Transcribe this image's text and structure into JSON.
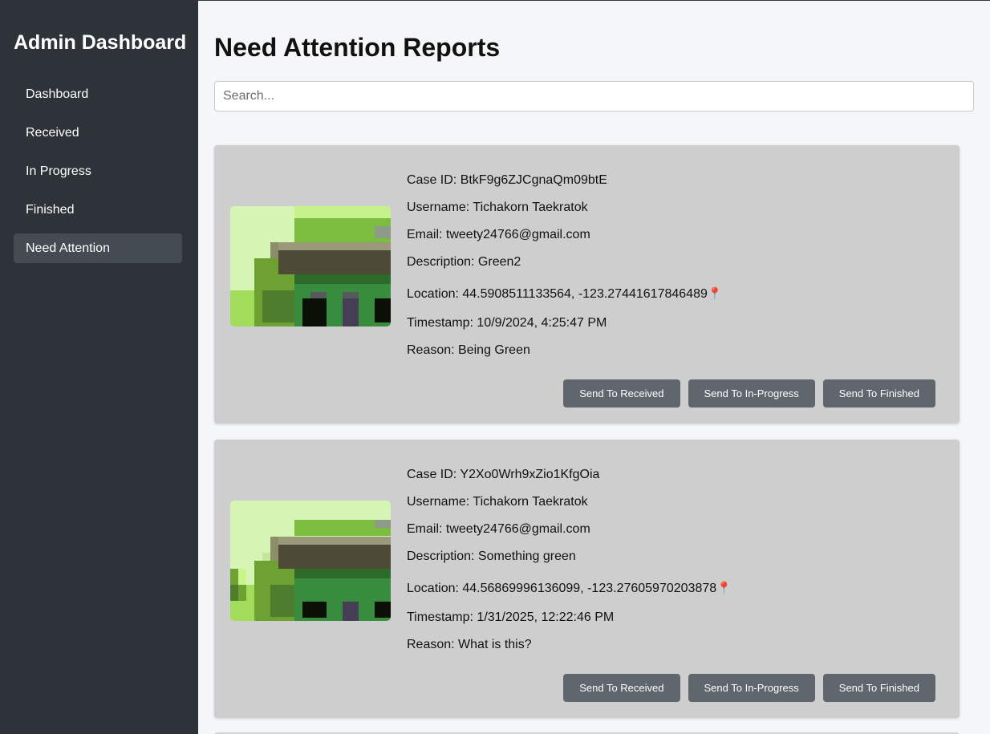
{
  "sidebar": {
    "title": "Admin Dashboard",
    "items": [
      {
        "label": "Dashboard"
      },
      {
        "label": "Received"
      },
      {
        "label": "In Progress"
      },
      {
        "label": "Finished"
      },
      {
        "label": "Need Attention"
      }
    ],
    "active_item": "Need Attention"
  },
  "main": {
    "title": "Need Attention Reports",
    "search": {
      "placeholder": "Search...",
      "value": ""
    }
  },
  "reports": [
    {
      "case_id": "Case ID: BtkF9g6ZJCgnaQm09btE",
      "username": "Username: Tichakorn Taekratok",
      "email": "Email: tweety24766@gmail.com",
      "description": "Description: Green2",
      "location": "Location: 44.5908511133564, -123.27441617846489",
      "timestamp": "Timestamp: 10/9/2024, 4:25:47 PM",
      "reason": "Reason: Being Green",
      "buttons": {
        "received": "Send To Received",
        "in_progress": "Send To In-Progress",
        "finished": "Send To Finished"
      }
    },
    {
      "case_id": "Case ID: Y2Xo0Wrh9xZio1KfgOia",
      "username": "Username: Tichakorn Taekratok",
      "email": "Email: tweety24766@gmail.com",
      "description": "Description: Something green",
      "location": "Location: 44.56869996136099, -123.27605970203878",
      "timestamp": "Timestamp: 1/31/2025, 12:22:46 PM",
      "reason": "Reason: What is this?",
      "buttons": {
        "received": "Send To Received",
        "in_progress": "Send To In-Progress",
        "finished": "Send To Finished"
      }
    }
  ],
  "icons": {
    "location_pin": "📍"
  },
  "colors": {
    "sidebar_bg": "#2d3338",
    "card_bg": "#cecece",
    "button_bg": "#5f666d",
    "active_nav": "#454b52"
  }
}
